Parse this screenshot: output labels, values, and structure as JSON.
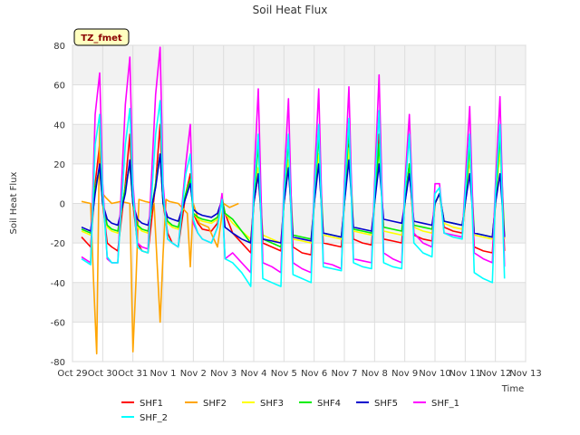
{
  "chart_data": {
    "type": "line",
    "title": "Soil Heat Flux",
    "xlabel": "Time",
    "ylabel": "Soil Heat Flux",
    "badge": "TZ_fmet",
    "xlim": [
      0,
      15
    ],
    "ylim": [
      -80,
      80
    ],
    "x_ticks": [
      "Oct 29",
      "Oct 30",
      "Oct 31",
      "Nov 1",
      "Nov 2",
      "Nov 3",
      "Nov 4",
      "Nov 5",
      "Nov 6",
      "Nov 7",
      "Nov 8",
      "Nov 9",
      "Nov 10",
      "Nov 11",
      "Nov 12",
      "Nov 13"
    ],
    "y_ticks": [
      -80,
      -60,
      -40,
      -20,
      0,
      20,
      40,
      60,
      80
    ],
    "grid": true,
    "legend_position": "bottom",
    "series": [
      {
        "name": "SHF1",
        "color": "#ff0000",
        "x": [
          0.3,
          0.6,
          0.75,
          0.9,
          1.0,
          1.15,
          1.3,
          1.5,
          1.75,
          1.9,
          2.0,
          2.15,
          2.3,
          2.5,
          2.75,
          2.9,
          3.0,
          3.15,
          3.3,
          3.5,
          3.75,
          3.9,
          4.0,
          4.15,
          4.3,
          4.6,
          4.8,
          4.95,
          5.05,
          5.3,
          5.6,
          5.9,
          6.0,
          6.15,
          6.3,
          6.6,
          6.9,
          7.0,
          7.15,
          7.3,
          7.6,
          7.9,
          8.0,
          8.15,
          8.3,
          8.6,
          8.9,
          9.0,
          9.15,
          9.3,
          9.6,
          9.9,
          10.0,
          10.15,
          10.3,
          10.6,
          10.9,
          11.0,
          11.15,
          11.3,
          11.6,
          11.9,
          12.0,
          12.15,
          12.3,
          12.6,
          12.9,
          13.0,
          13.15,
          13.3,
          13.6,
          13.9,
          14.0,
          14.15,
          14.3
        ],
        "y": [
          -17,
          -22,
          10,
          30,
          0,
          -20,
          -22,
          -24,
          10,
          35,
          0,
          -20,
          -24,
          -25,
          10,
          40,
          0,
          -15,
          -20,
          -22,
          5,
          15,
          -5,
          -10,
          -13,
          -14,
          -10,
          3,
          -5,
          -15,
          -20,
          -25,
          0,
          15,
          -20,
          -22,
          -24,
          0,
          20,
          -22,
          -25,
          -26,
          0,
          25,
          -20,
          -21,
          -22,
          0,
          30,
          -18,
          -20,
          -21,
          0,
          35,
          -18,
          -19,
          -20,
          0,
          20,
          -16,
          -18,
          -19,
          0,
          5,
          -12,
          -14,
          -15,
          0,
          25,
          -22,
          -24,
          -25,
          0,
          30,
          -24
        ]
      },
      {
        "name": "SHF2",
        "color": "#ffa500",
        "x": [
          0.3,
          0.6,
          0.7,
          0.8,
          0.9,
          1.0,
          1.1,
          1.3,
          1.6,
          1.9,
          2.0,
          2.1,
          2.2,
          2.4,
          2.7,
          2.9,
          3.0,
          3.1,
          3.2,
          3.5,
          3.8,
          3.9,
          4.0,
          4.2,
          4.5,
          4.8,
          5.0,
          5.2,
          5.5
        ],
        "y": [
          1,
          0,
          -40,
          -76,
          40,
          5,
          3,
          0,
          1,
          0,
          -75,
          -40,
          2,
          1,
          0,
          -60,
          -25,
          2,
          1,
          0,
          -5,
          -32,
          0,
          -10,
          -12,
          -22,
          0,
          -2,
          0
        ]
      },
      {
        "name": "SHF3",
        "color": "#ffff00",
        "x": [
          0.3,
          0.6,
          0.75,
          0.9,
          1.0,
          1.15,
          1.3,
          1.5,
          1.75,
          1.9,
          2.0,
          2.15,
          2.3,
          2.5,
          2.75,
          2.9,
          3.0,
          3.15,
          3.3,
          3.5,
          3.75,
          3.9,
          4.0,
          4.15,
          4.3,
          4.6,
          4.8,
          4.95,
          5.05,
          5.3,
          5.6,
          5.9,
          6.0,
          6.15,
          6.3,
          6.6,
          6.9,
          7.0,
          7.15,
          7.3,
          7.6,
          7.9,
          8.0,
          8.15,
          8.3,
          8.6,
          8.9,
          9.0,
          9.15,
          9.3,
          9.6,
          9.9,
          10.0,
          10.15,
          10.3,
          10.6,
          10.9,
          11.0,
          11.15,
          11.3,
          11.6,
          11.9,
          12.0,
          12.15,
          12.3,
          12.6,
          12.9,
          13.0,
          13.15,
          13.3,
          13.6,
          13.9,
          14.0,
          14.15,
          14.3
        ],
        "y": [
          -14,
          -16,
          8,
          18,
          0,
          -12,
          -14,
          -15,
          8,
          20,
          0,
          -12,
          -14,
          -15,
          10,
          25,
          0,
          -10,
          -12,
          -13,
          5,
          12,
          -5,
          -8,
          -9,
          -10,
          -8,
          2,
          -5,
          -10,
          -14,
          -18,
          0,
          18,
          -16,
          -18,
          -20,
          0,
          22,
          -18,
          -19,
          -20,
          0,
          25,
          -16,
          -17,
          -18,
          0,
          28,
          -14,
          -15,
          -16,
          0,
          28,
          -14,
          -15,
          -16,
          0,
          18,
          -12,
          -14,
          -15,
          0,
          5,
          -10,
          -12,
          -13,
          0,
          25,
          -16,
          -17,
          -18,
          0,
          28,
          -18
        ]
      },
      {
        "name": "SHF4",
        "color": "#00ee00",
        "x": [
          0.3,
          0.6,
          0.75,
          0.9,
          1.0,
          1.15,
          1.3,
          1.5,
          1.75,
          1.9,
          2.0,
          2.15,
          2.3,
          2.5,
          2.75,
          2.9,
          3.0,
          3.15,
          3.3,
          3.5,
          3.75,
          3.9,
          4.0,
          4.15,
          4.3,
          4.6,
          4.8,
          4.95,
          5.05,
          5.3,
          5.6,
          5.9,
          6.0,
          6.15,
          6.3,
          6.6,
          6.9,
          7.0,
          7.15,
          7.3,
          7.6,
          7.9,
          8.0,
          8.15,
          8.3,
          8.6,
          8.9,
          9.0,
          9.15,
          9.3,
          9.6,
          9.9,
          10.0,
          10.15,
          10.3,
          10.6,
          10.9,
          11.0,
          11.15,
          11.3,
          11.6,
          11.9,
          12.0,
          12.15,
          12.3,
          12.6,
          12.9,
          13.0,
          13.15,
          13.3,
          13.6,
          13.9,
          14.0,
          14.15,
          14.3
        ],
        "y": [
          -13,
          -15,
          8,
          18,
          0,
          -11,
          -13,
          -14,
          8,
          20,
          0,
          -11,
          -13,
          -14,
          10,
          25,
          0,
          -9,
          -11,
          -12,
          5,
          12,
          -5,
          -7,
          -8,
          -9,
          -7,
          2,
          -5,
          -8,
          -14,
          -20,
          0,
          30,
          -18,
          -20,
          -22,
          0,
          32,
          -16,
          -17,
          -18,
          0,
          35,
          -15,
          -16,
          -17,
          0,
          38,
          -13,
          -14,
          -15,
          0,
          30,
          -12,
          -13,
          -14,
          0,
          20,
          -11,
          -12,
          -13,
          0,
          5,
          -9,
          -10,
          -11,
          0,
          30,
          -15,
          -16,
          -17,
          0,
          35,
          -17
        ]
      },
      {
        "name": "SHF5",
        "color": "#0000cd",
        "x": [
          0.3,
          0.6,
          0.75,
          0.9,
          1.0,
          1.15,
          1.3,
          1.5,
          1.75,
          1.9,
          2.0,
          2.15,
          2.3,
          2.5,
          2.75,
          2.9,
          3.0,
          3.15,
          3.3,
          3.5,
          3.75,
          3.9,
          4.0,
          4.15,
          4.3,
          4.6,
          4.8,
          4.95,
          5.05,
          5.3,
          5.6,
          5.9,
          6.0,
          6.15,
          6.3,
          6.6,
          6.9,
          7.0,
          7.15,
          7.3,
          7.6,
          7.9,
          8.0,
          8.15,
          8.3,
          8.6,
          8.9,
          9.0,
          9.15,
          9.3,
          9.6,
          9.9,
          10.0,
          10.15,
          10.3,
          10.6,
          10.9,
          11.0,
          11.15,
          11.3,
          11.6,
          11.9,
          12.0,
          12.15,
          12.3,
          12.6,
          12.9,
          13.0,
          13.15,
          13.3,
          13.6,
          13.9,
          14.0,
          14.15,
          14.3
        ],
        "y": [
          -12,
          -14,
          5,
          20,
          0,
          -8,
          -10,
          -11,
          5,
          22,
          0,
          -8,
          -10,
          -11,
          8,
          25,
          0,
          -7,
          -8,
          -9,
          3,
          10,
          -3,
          -5,
          -6,
          -7,
          -5,
          2,
          -12,
          -15,
          -18,
          -20,
          0,
          15,
          -18,
          -19,
          -20,
          0,
          18,
          -17,
          -18,
          -19,
          0,
          20,
          -15,
          -16,
          -17,
          0,
          22,
          -12,
          -13,
          -14,
          0,
          20,
          -8,
          -9,
          -10,
          0,
          15,
          -9,
          -10,
          -11,
          0,
          5,
          -9,
          -10,
          -11,
          0,
          15,
          -15,
          -16,
          -17,
          0,
          15,
          -17
        ]
      },
      {
        "name": "SHF_1",
        "color": "#ff00ff",
        "x": [
          0.3,
          0.6,
          0.75,
          0.9,
          1.0,
          1.15,
          1.3,
          1.5,
          1.75,
          1.9,
          2.0,
          2.15,
          2.3,
          2.5,
          2.75,
          2.9,
          3.0,
          3.15,
          3.3,
          3.5,
          3.75,
          3.9,
          4.0,
          4.15,
          4.3,
          4.6,
          4.8,
          4.95,
          5.05,
          5.3,
          5.6,
          5.9,
          6.0,
          6.15,
          6.3,
          6.6,
          6.9,
          7.0,
          7.15,
          7.3,
          7.6,
          7.9,
          8.0,
          8.15,
          8.3,
          8.6,
          8.9,
          9.0,
          9.15,
          9.3,
          9.6,
          9.9,
          10.0,
          10.15,
          10.3,
          10.6,
          10.9,
          11.0,
          11.15,
          11.3,
          11.6,
          11.9,
          12.0,
          12.15,
          12.3,
          12.6,
          12.9,
          13.0,
          13.15,
          13.3,
          13.6,
          13.9,
          14.0,
          14.15,
          14.3
        ],
        "y": [
          -27,
          -30,
          45,
          66,
          10,
          -28,
          -30,
          -30,
          50,
          74,
          10,
          -20,
          -22,
          -23,
          55,
          79,
          10,
          -18,
          -20,
          -22,
          20,
          40,
          -10,
          -15,
          -18,
          -20,
          -12,
          5,
          -28,
          -25,
          -30,
          -35,
          10,
          58,
          -30,
          -32,
          -35,
          10,
          53,
          -30,
          -33,
          -35,
          10,
          58,
          -30,
          -31,
          -33,
          10,
          59,
          -28,
          -29,
          -30,
          10,
          65,
          -25,
          -28,
          -30,
          10,
          45,
          -15,
          -20,
          -22,
          10,
          10,
          -15,
          -16,
          -17,
          10,
          49,
          -25,
          -28,
          -30,
          10,
          54,
          -32
        ]
      },
      {
        "name": "SHF_2",
        "color": "#00ffff",
        "x": [
          0.3,
          0.6,
          0.75,
          0.9,
          1.0,
          1.15,
          1.3,
          1.5,
          1.75,
          1.9,
          2.0,
          2.15,
          2.3,
          2.5,
          2.75,
          2.9,
          3.0,
          3.15,
          3.3,
          3.5,
          3.75,
          3.9,
          4.0,
          4.15,
          4.3,
          4.6,
          4.8,
          4.95,
          5.05,
          5.3,
          5.6,
          5.9,
          6.0,
          6.15,
          6.3,
          6.6,
          6.9,
          7.0,
          7.15,
          7.3,
          7.6,
          7.9,
          8.0,
          8.15,
          8.3,
          8.6,
          8.9,
          9.0,
          9.15,
          9.3,
          9.6,
          9.9,
          10.0,
          10.15,
          10.3,
          10.6,
          10.9,
          11.0,
          11.15,
          11.3,
          11.6,
          11.9,
          12.0,
          12.15,
          12.3,
          12.6,
          12.9,
          13.0,
          13.15,
          13.3,
          13.6,
          13.9,
          14.0,
          14.15,
          14.3
        ],
        "y": [
          -28,
          -31,
          30,
          45,
          5,
          -27,
          -30,
          -30,
          30,
          48,
          5,
          -22,
          -24,
          -25,
          35,
          52,
          5,
          -18,
          -20,
          -22,
          15,
          25,
          -8,
          -15,
          -18,
          -20,
          -12,
          2,
          -28,
          -30,
          -35,
          -42,
          5,
          35,
          -38,
          -40,
          -42,
          5,
          35,
          -36,
          -38,
          -40,
          5,
          40,
          -32,
          -33,
          -34,
          5,
          43,
          -30,
          -32,
          -33,
          5,
          47,
          -30,
          -32,
          -33,
          5,
          35,
          -20,
          -25,
          -27,
          5,
          8,
          -15,
          -17,
          -18,
          5,
          35,
          -35,
          -38,
          -40,
          5,
          40,
          -38
        ]
      }
    ]
  }
}
